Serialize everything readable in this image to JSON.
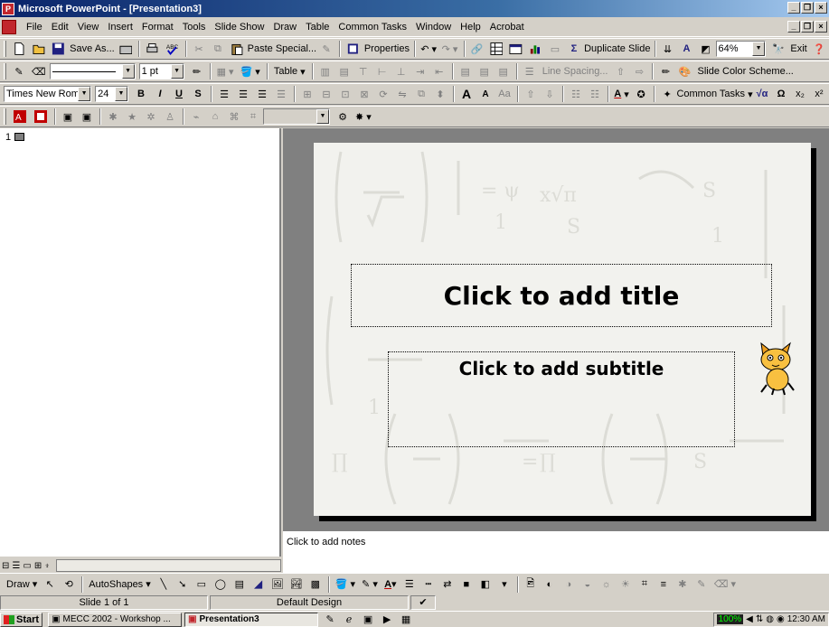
{
  "window": {
    "title": "Microsoft PowerPoint - [Presentation3]"
  },
  "menu": [
    "File",
    "Edit",
    "View",
    "Insert",
    "Format",
    "Tools",
    "Slide Show",
    "Draw",
    "Table",
    "Common Tasks",
    "Window",
    "Help",
    "Acrobat"
  ],
  "standard_toolbar": {
    "save_as": "Save As...",
    "paste_special": "Paste Special...",
    "properties": "Properties",
    "duplicate_slide": "Duplicate Slide",
    "zoom": "64%",
    "exit": "Exit"
  },
  "line_toolbar": {
    "line_weight": "1 pt",
    "table": "Table",
    "line_spacing": "Line Spacing...",
    "slide_color_scheme": "Slide Color Scheme..."
  },
  "formatting_toolbar": {
    "font": "Times New Roman",
    "size": "24",
    "common_tasks": "Common Tasks"
  },
  "outline": {
    "slide_number": "1"
  },
  "slide": {
    "title_placeholder": "Click to add title",
    "subtitle_placeholder": "Click to add subtitle"
  },
  "notes": {
    "placeholder": "Click to add notes"
  },
  "drawing_toolbar": {
    "draw": "Draw",
    "autoshapes": "AutoShapes"
  },
  "status": {
    "slide": "Slide 1 of 1",
    "design": "Default Design"
  },
  "taskbar": {
    "start": "Start",
    "tasks": [
      {
        "label": "MECC 2002 - Workshop ..."
      },
      {
        "label": "Presentation3"
      }
    ],
    "tray_zoom": "100%",
    "time": "12:30 AM"
  },
  "colors": {
    "title_bar": "#0a246a",
    "app_icon": "#c1272d",
    "slide_bg": "#f2f2ee",
    "workspace": "#808080"
  }
}
